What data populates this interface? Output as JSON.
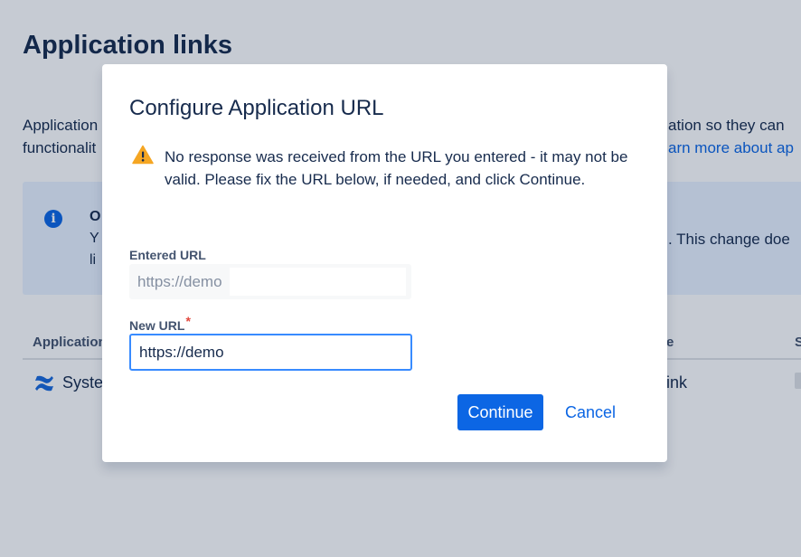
{
  "page": {
    "title": "Application links",
    "intro_line1_start": "Application",
    "intro_line2_start": "functionalit",
    "intro_line1_end": "ation so they can",
    "intro_line2_end_link": "arn more about ap"
  },
  "info_banner": {
    "title_fragment": "O",
    "line1_fragment": "Y",
    "line2_fragment": "li",
    "right_fragment": ". This change doe"
  },
  "table": {
    "headers": {
      "application": "Application",
      "type": "e",
      "status": "S"
    },
    "rows": [
      {
        "name": "Syste",
        "type": "ink"
      }
    ]
  },
  "modal": {
    "title": "Configure Application URL",
    "warning": "No response was received from the URL you entered - it may not be valid. Please fix the URL below, if needed, and click Continue.",
    "entered_url_label": "Entered URL",
    "entered_url_value": "https://demo",
    "new_url_label": "New URL",
    "required_marker": "*",
    "new_url_value": "https://demo",
    "continue_label": "Continue",
    "cancel_label": "Cancel"
  },
  "colors": {
    "primary": "#0c66e4",
    "warning": "#f5a623",
    "info_bg": "#e9f2ff",
    "required": "#e2483d"
  },
  "icons": {
    "info": "info-icon",
    "warning": "warning-icon",
    "app": "confluence-icon"
  }
}
